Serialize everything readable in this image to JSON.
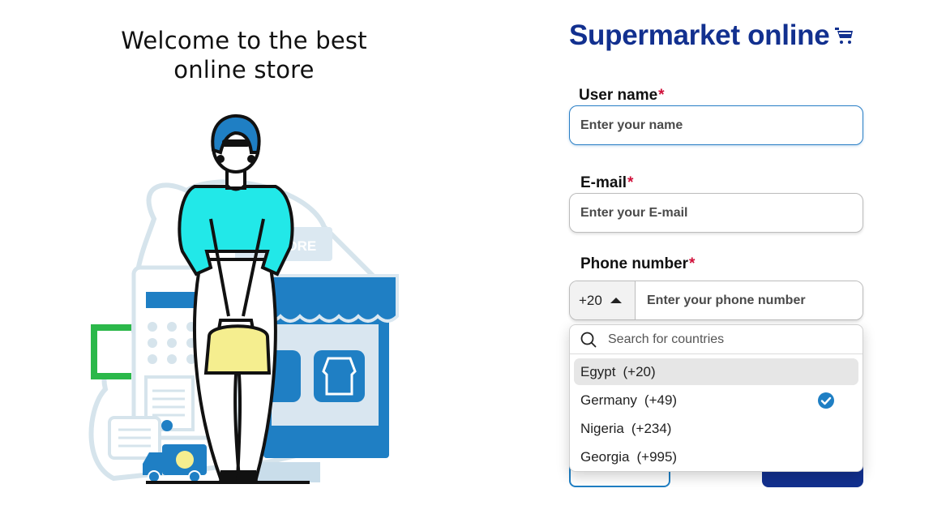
{
  "welcome": {
    "line1": "Welcome to the best",
    "line2": "online store"
  },
  "brand": {
    "title": "Supermarket online",
    "icon": "shopping-cart-icon",
    "color": "#12308f"
  },
  "illustration": {
    "sign_text": "STORE"
  },
  "form": {
    "username": {
      "label": "User name",
      "required_mark": "*",
      "placeholder": "Enter your name",
      "value": ""
    },
    "email": {
      "label": "E-mail",
      "required_mark": "*",
      "placeholder": "Enter your E-mail",
      "value": ""
    },
    "phone": {
      "label": "Phone number",
      "required_mark": "*",
      "dial_code": "+20",
      "placeholder": "Enter your phone number",
      "value": ""
    }
  },
  "country_dropdown": {
    "search_placeholder": "Search for countries",
    "countries": [
      {
        "name": "Egypt",
        "code": "(+20)",
        "hovered": true,
        "selected": false
      },
      {
        "name": "Germany",
        "code": "(+49)",
        "hovered": false,
        "selected": true
      },
      {
        "name": "Nigeria",
        "code": "(+234)",
        "hovered": false,
        "selected": false
      },
      {
        "name": "Georgia",
        "code": "(+995)",
        "hovered": false,
        "selected": false
      }
    ]
  },
  "colors": {
    "accent": "#1f7fc4",
    "required": "#d0103a",
    "primary_button": "#12308f"
  }
}
